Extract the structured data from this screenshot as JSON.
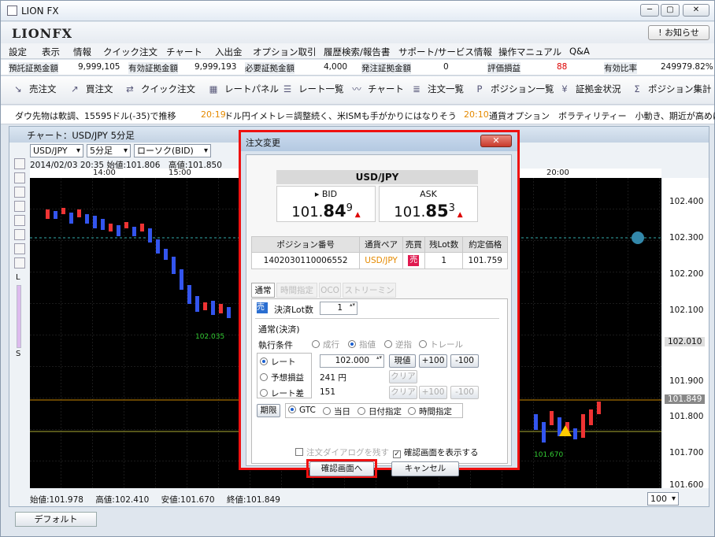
{
  "window": {
    "title": "LION FX",
    "controls": [
      "─",
      "▢",
      "✕"
    ]
  },
  "brand": {
    "logo": "LIONFX",
    "notice_button": "お知らせ"
  },
  "menu": [
    "設定",
    "表示",
    "情報",
    "クイック注文",
    "チャート",
    "入出金",
    "オプション取引",
    "履歴検索/報告書",
    "サポート/サービス情報",
    "操作マニュアル",
    "Q&A"
  ],
  "account": [
    {
      "label": "預託証拠金額",
      "value": "9,999,105"
    },
    {
      "label": "有効証拠金額",
      "value": "9,999,193"
    },
    {
      "label": "必要証拠金額",
      "value": "4,000"
    },
    {
      "label": "発注証拠金額",
      "value": "0"
    },
    {
      "label": "評価損益",
      "value": "88"
    },
    {
      "label": "有効比率",
      "value": "249979.82%"
    }
  ],
  "toolbar": [
    {
      "label": "売注文",
      "icon": "sell-arrow-icon"
    },
    {
      "label": "買注文",
      "icon": "buy-arrow-icon"
    },
    {
      "label": "クイック注文",
      "icon": "quick-order-icon"
    },
    {
      "label": "レートパネル",
      "icon": "rate-panel-icon"
    },
    {
      "label": "レート一覧",
      "icon": "rate-list-icon"
    },
    {
      "label": "チャート",
      "icon": "chart-icon"
    },
    {
      "label": "注文一覧",
      "icon": "order-list-icon"
    },
    {
      "label": "ポジション一覧",
      "icon": "position-list-icon"
    },
    {
      "label": "証拠金状況",
      "icon": "margin-status-icon"
    },
    {
      "label": "ポジション集計",
      "icon": "position-summary-icon"
    }
  ],
  "news": {
    "item1": "ダウ先物は軟調、15595ドル(-35)で推移",
    "time2": "20:19",
    "item2": "ドル円イメトレ＝調整続く、米ISMも手がかりにはなりそう",
    "time3": "20:10",
    "item3": "通貨オプション　ボラティリティー　小動き、期近が高めに推移"
  },
  "chart": {
    "title": "チャート：USD/JPY 5分足",
    "pair_select": "USD/JPY",
    "period_select": "5分足",
    "type_select": "ローソク(BID)",
    "ohlc_header": "2014/02/03 20:35  始値:101.806　高値:101.850",
    "time_labels": [
      "14:00",
      "15:00",
      "20:00"
    ],
    "y_labels": [
      "102.400",
      "102.300",
      "102.200",
      "102.100",
      "102.010",
      "101.900",
      "101.849",
      "101.800",
      "101.700",
      "101.600"
    ],
    "annotations": [
      "102.035",
      "101.670"
    ],
    "bottom": {
      "open": "始値:101.978",
      "high": "高値:102.410",
      "low": "安値:101.670",
      "close": "終値:101.849"
    },
    "zoom": "100",
    "left_scale": [
      "L",
      "S"
    ]
  },
  "tabbar": {
    "default_tab": "デフォルト"
  },
  "dialog": {
    "title": "注文変更",
    "pair": "USD/JPY",
    "bid": {
      "label": "BID",
      "int": "101.",
      "big": "84",
      "sup": "9"
    },
    "ask": {
      "label": "ASK",
      "int": "101.",
      "big": "85",
      "sup": "3"
    },
    "table_headers": [
      "ポジション番号",
      "通貨ペア",
      "売買",
      "残Lot数",
      "約定価格"
    ],
    "table_row": {
      "id": "1402030110006552",
      "pair": "USD/JPY",
      "side": "売",
      "lots": "1",
      "price": "101.759"
    },
    "tabs": [
      "通常",
      "時間指定",
      "OCO",
      "ストリーミング"
    ],
    "lot_label": "決済Lot数",
    "lot_value": "1",
    "side_badge": "売",
    "section": "通常(決済)",
    "exec_label": "執行条件",
    "exec_options": [
      "成行",
      "指値",
      "逆指",
      "トレール"
    ],
    "rate_label": "レート",
    "rate_value": "102.000",
    "expected_label": "予想損益",
    "expected_value": "241 円",
    "diff_label": "レート差",
    "diff_value": "151",
    "btn_current": "現値",
    "btn_plus": "+100",
    "btn_minus": "-100",
    "btn_clear": "クリア",
    "term_label": "期限",
    "term_options": [
      "GTC",
      "当日",
      "日付指定",
      "時間指定"
    ],
    "chk_remain": "注文ダイアログを残す",
    "chk_confirm": "確認画面を表示する",
    "btn_confirm": "確認画面へ",
    "btn_cancel": "キャンセル"
  }
}
